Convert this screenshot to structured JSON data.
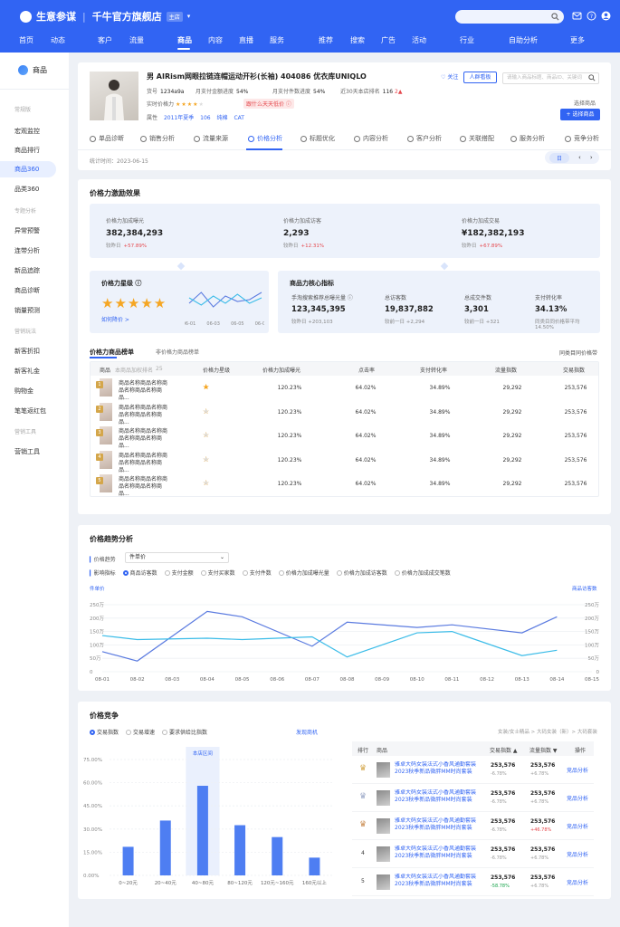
{
  "header": {
    "brand": "生意参谋",
    "store": "千牛官方旗舰店",
    "store_tag": "主店",
    "nav": [
      "首页",
      "动态",
      "客户",
      "流量",
      "商品",
      "内容",
      "直播",
      "服务",
      "推荐",
      "搜索",
      "广告",
      "活动",
      "行业",
      "自助分析",
      "更多"
    ],
    "nav_active": "商品"
  },
  "sidebar": {
    "title": "商品",
    "groups": [
      {
        "label": "常规版",
        "items": [
          "宏观监控",
          "商品排行",
          "商品360",
          "品类360"
        ]
      },
      {
        "label": "专题分析",
        "items": [
          "异常预警",
          "连带分析",
          "新品追踪",
          "商品诊断",
          "销量预测"
        ]
      },
      {
        "label": "营销玩法",
        "items": [
          "新客折扣",
          "新客礼金",
          "购物金",
          "笔笔返红包"
        ]
      },
      {
        "label": "营销工具",
        "items": [
          "营销工具"
        ]
      }
    ],
    "active": "商品360"
  },
  "product": {
    "name": "男 AIRism网眼拉链连帽运动开衫(长袖) 404086 优衣库UNIQLO",
    "id_label": "货号",
    "id": "1234a9a",
    "payrate_label": "月支付金额进度",
    "payrate": "54%",
    "paycnt_label": "月支付件数进度",
    "paycnt": "54%",
    "rank_label": "近30天本店排名",
    "rank": "116",
    "rank_change": "2▲",
    "pp_label": "实时价格力",
    "promo": "跟什么天天低价 ⓘ",
    "attr_label": "属性",
    "attrs": [
      "2011年夏季",
      "106",
      "纯棉",
      "CAT"
    ],
    "follow": "关注",
    "people_btn": "人群看板",
    "search_placeholder": "请输入商品标题、商品ID、关键词",
    "pick_label": "选择商品",
    "pick_btn": "+ 选择商品",
    "tabs": [
      "单品诊断",
      "销售分析",
      "流量来源",
      "价格分析",
      "标题优化",
      "内容分析",
      "客户分析",
      "关联搭配",
      "服务分析",
      "竞争分析"
    ],
    "active_tab": "价格分析",
    "stat_time": "统计时间：2023-06-15",
    "date_btn": "日"
  },
  "effect": {
    "title": "价格力激励效果",
    "kpis": [
      {
        "label": "价格力加成曝光",
        "value": "382,384,293",
        "cmp": "较昨日",
        "chg": "+57.89%"
      },
      {
        "label": "价格力加成访客",
        "value": "2,293",
        "cmp": "较昨日",
        "chg": "+12.31%"
      },
      {
        "label": "价格力加成交易",
        "value": "¥182,382,193",
        "cmp": "较昨日",
        "chg": "+67.89%"
      }
    ],
    "star_title": "价格力星级 ⓘ",
    "star_count": 5,
    "improve": "如何降价 >",
    "mini_x": [
      "06-01",
      "06-03",
      "06-05",
      "06-07"
    ],
    "core_title": "商品力核心指标",
    "core": [
      {
        "label": "手淘搜索推荐总曝光量 ⓘ",
        "value": "123,345,395",
        "cmp": "较昨日 +203,103"
      },
      {
        "label": "总访客数",
        "value": "19,837,882",
        "cmp": "较前一日 +2,294"
      },
      {
        "label": "总成交件数",
        "value": "3,301",
        "cmp": "较前一日 +321"
      },
      {
        "label": "支付转化率",
        "value": "34.13%",
        "cmp": "同类目同价格带平均 14.50%"
      }
    ]
  },
  "ranking": {
    "tab1": "价格力商品榜单",
    "tab2": "非价格力商品榜单",
    "link": "同类目同价格带",
    "headers": [
      "商品",
      "本商品加权排名",
      "25",
      "价格力星级",
      "价格力加成曝光",
      "点击率",
      "支付转化率",
      "流量指数",
      "交易指数"
    ],
    "rows": [
      {
        "rank": "1",
        "name": "商品名称商品名称商品名称商品名称商品...",
        "stars": 5,
        "exposure": "120.23%",
        "ctr": "64.02%",
        "conv": "34.89%",
        "flow": "29,292",
        "trade": "253,576"
      },
      {
        "rank": "2",
        "name": "商品名称商品名称商品名称商品名称商品...",
        "stars": 4,
        "exposure": "120.23%",
        "ctr": "64.02%",
        "conv": "34.89%",
        "flow": "29,292",
        "trade": "253,576"
      },
      {
        "rank": "3",
        "name": "商品名称商品名称商品名称商品名称商品...",
        "stars": 4,
        "exposure": "120.23%",
        "ctr": "64.02%",
        "conv": "34.89%",
        "flow": "29,292",
        "trade": "253,576"
      },
      {
        "rank": "4",
        "name": "商品名称商品名称商品名称商品名称商品...",
        "stars": 4,
        "exposure": "120.23%",
        "ctr": "64.02%",
        "conv": "34.89%",
        "flow": "29,292",
        "trade": "253,576"
      },
      {
        "rank": "5",
        "name": "商品名称商品名称商品名称商品名称商品...",
        "stars": 4,
        "exposure": "120.23%",
        "ctr": "64.02%",
        "conv": "34.89%",
        "flow": "29,292",
        "trade": "253,576"
      }
    ]
  },
  "trend": {
    "title": "价格趋势分析",
    "price_label": "价格趋势",
    "price_select": "件单价",
    "impact_label": "影响指标",
    "radios": [
      "商品访客数",
      "支付金额",
      "支付买家数",
      "支付件数",
      "价格力加成曝光量",
      "价格力加成访客数",
      "价格力加成成交笔数"
    ],
    "radio_on": 0,
    "left_axis_title": "件单价",
    "right_axis_title": "商品访客数",
    "y_ticks": [
      "250万",
      "200万",
      "150万",
      "100万",
      "50万",
      "0"
    ],
    "x_ticks": [
      "08-01",
      "08-02",
      "08-03",
      "08-04",
      "08-05",
      "08-06",
      "08-07",
      "08-08",
      "08-09",
      "08-10",
      "08-11",
      "08-12",
      "08-13",
      "08-14",
      "08-15"
    ]
  },
  "compete": {
    "title": "价格竞争",
    "radios": [
      "交易指数",
      "交易增速",
      "要求供给比指数"
    ],
    "discover": "发现商机",
    "crumb": "女装/女士精品 > 大码女装（新）> 大码套装",
    "table_headers": [
      "排行",
      "商品",
      "交易指数 ▲",
      "流量指数 ▼",
      "操作"
    ],
    "rows": [
      {
        "rank": "1",
        "name": "雅卓大码女装法式小香风通勤套装2023秋季新品微胖MM时尚套装",
        "trade": "253,576",
        "trade_chg": "-6.78%",
        "flow": "253,576",
        "flow_chg": "+6.78%",
        "op": "竞品分析"
      },
      {
        "rank": "2",
        "name": "雅卓大码女装法式小香风通勤套装2023秋季新品微胖MM时尚套装",
        "trade": "253,576",
        "trade_chg": "-6.78%",
        "flow": "253,576",
        "flow_chg": "+6.78%",
        "op": "竞品分析"
      },
      {
        "rank": "3",
        "name": "雅卓大码女装法式小香风通勤套装2023秋季新品微胖MM时尚套装",
        "trade": "253,576",
        "trade_chg": "-6.78%",
        "flow": "253,576",
        "flow_chg": "+46.78%",
        "op": "竞品分析"
      },
      {
        "rank": "4",
        "name": "雅卓大码女装法式小香风通勤套装2023秋季新品微胖MM时尚套装",
        "trade": "253,576",
        "trade_chg": "-6.78%",
        "flow": "253,576",
        "flow_chg": "+6.78%",
        "op": "竞品分析"
      },
      {
        "rank": "5",
        "name": "雅卓大码女装法式小香风通勤套装2023秋季新品微胖MM时尚套装",
        "trade": "253,576",
        "trade_chg": "-58.78%",
        "flow": "253,576",
        "flow_chg": "+6.78%",
        "op": "竞品分析"
      }
    ],
    "highlight_label": "本店区间"
  },
  "chart_data": [
    {
      "type": "line",
      "x": [
        "06-01",
        "06-02",
        "06-03",
        "06-04",
        "06-05",
        "06-06",
        "06-07"
      ],
      "series": [
        {
          "values": [
            3.0,
            6.0,
            2.0,
            5.0,
            3.5,
            4.0,
            6.0
          ]
        },
        {
          "values": [
            4.5,
            2.5,
            5.0,
            3.0,
            5.5,
            3.0,
            4.5
          ]
        }
      ],
      "ylim": [
        0,
        7
      ]
    },
    {
      "type": "line",
      "x": [
        "08-01",
        "08-02",
        "08-03",
        "08-04",
        "08-05",
        "08-06",
        "08-07",
        "08-08",
        "08-09",
        "08-10",
        "08-11",
        "08-12",
        "08-13",
        "08-14",
        "08-15"
      ],
      "series": [
        {
          "values": [
            75,
            40,
            null,
            225,
            205,
            null,
            95,
            185,
            null,
            165,
            175,
            null,
            145,
            205,
            null
          ]
        },
        {
          "values": [
            135,
            120,
            null,
            125,
            120,
            null,
            130,
            55,
            null,
            145,
            150,
            null,
            60,
            80,
            null
          ]
        }
      ],
      "ylim": [
        0,
        250
      ],
      "y_unit": "万"
    },
    {
      "type": "bar",
      "categories": [
        "0~20元",
        "20~40元",
        "40~80元",
        "80~120元",
        "120元~160元",
        "160元以上"
      ],
      "values": [
        18.5,
        35.5,
        58.0,
        32.5,
        24.8,
        11.5
      ],
      "ylim": [
        0,
        75
      ],
      "y_ticks": [
        "75.00%",
        "60.00%",
        "45.00%",
        "30.00%",
        "15.00%",
        "0.00%"
      ],
      "highlight": "40~80元"
    }
  ],
  "colors": {
    "primary": "#3164f3",
    "line1": "#5b7be0",
    "line2": "#3bbce8",
    "bar": "#4e7ef2"
  }
}
